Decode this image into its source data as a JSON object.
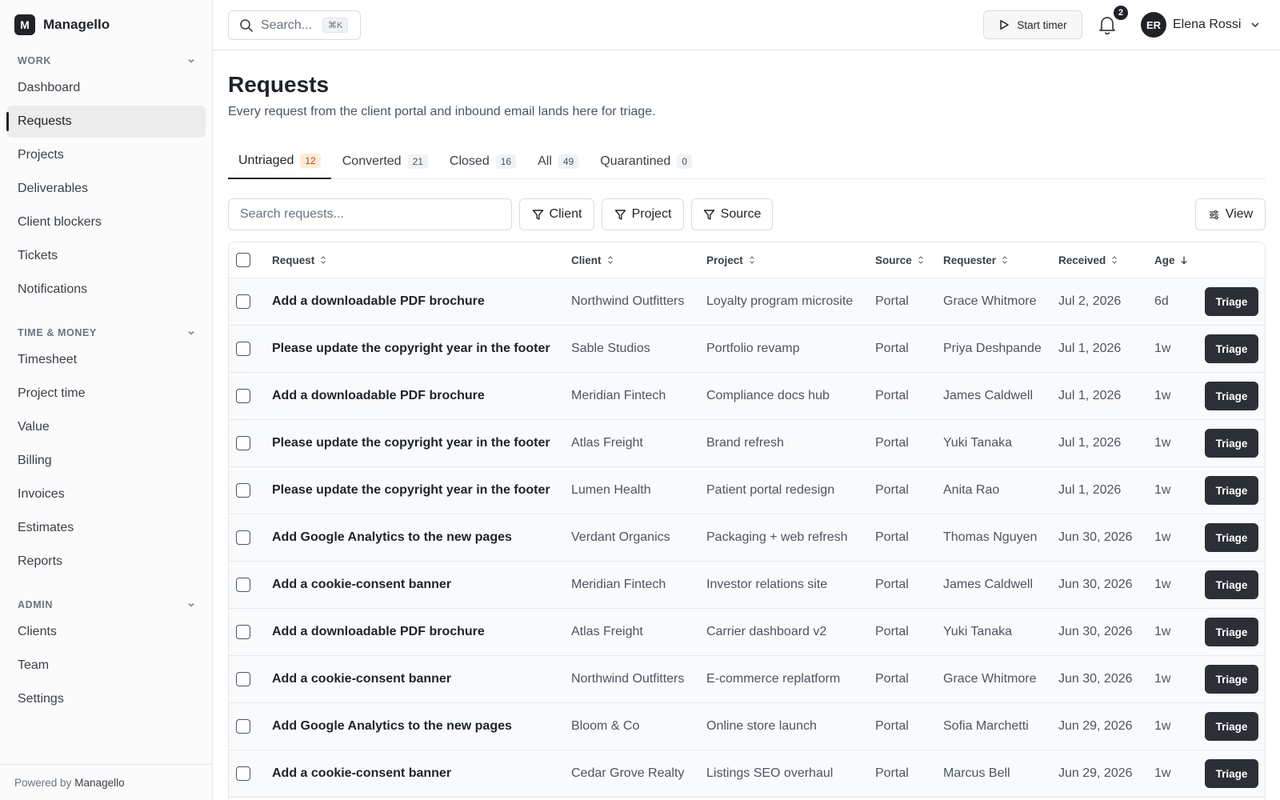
{
  "brand": {
    "logo_letter": "M",
    "name": "Managello"
  },
  "sidebar": {
    "sections": [
      {
        "title": "WORK",
        "items": [
          "Dashboard",
          "Requests",
          "Projects",
          "Deliverables",
          "Client blockers",
          "Tickets",
          "Notifications"
        ]
      },
      {
        "title": "TIME & MONEY",
        "items": [
          "Timesheet",
          "Project time",
          "Value",
          "Billing",
          "Invoices",
          "Estimates",
          "Reports"
        ]
      },
      {
        "title": "ADMIN",
        "items": [
          "Clients",
          "Team",
          "Settings"
        ]
      }
    ],
    "active_item": "Requests",
    "footer_prefix": "Powered by",
    "footer_brand": "Managello"
  },
  "topbar": {
    "search_placeholder": "Search...",
    "search_shortcut": "⌘K",
    "start_timer_label": "Start timer",
    "notification_count": "2",
    "user_initials": "ER",
    "user_name": "Elena Rossi"
  },
  "page": {
    "title": "Requests",
    "subtitle": "Every request from the client portal and inbound email lands here for triage."
  },
  "tabs": [
    {
      "label": "Untriaged",
      "count": "12",
      "active": true
    },
    {
      "label": "Converted",
      "count": "21",
      "active": false
    },
    {
      "label": "Closed",
      "count": "16",
      "active": false
    },
    {
      "label": "All",
      "count": "49",
      "active": false
    },
    {
      "label": "Quarantined",
      "count": "0",
      "active": false
    }
  ],
  "toolbar": {
    "search_placeholder": "Search requests...",
    "filter_client": "Client",
    "filter_project": "Project",
    "filter_source": "Source",
    "view_label": "View"
  },
  "table": {
    "columns": [
      "Request",
      "Client",
      "Project",
      "Source",
      "Requester",
      "Received",
      "Age"
    ],
    "action_label": "Triage",
    "rows": [
      [
        "Add a downloadable PDF brochure",
        "Northwind Outfitters",
        "Loyalty program microsite",
        "Portal",
        "Grace Whitmore",
        "Jul 2, 2026",
        "6d"
      ],
      [
        "Please update the copyright year in the footer",
        "Sable Studios",
        "Portfolio revamp",
        "Portal",
        "Priya Deshpande",
        "Jul 1, 2026",
        "1w"
      ],
      [
        "Add a downloadable PDF brochure",
        "Meridian Fintech",
        "Compliance docs hub",
        "Portal",
        "James Caldwell",
        "Jul 1, 2026",
        "1w"
      ],
      [
        "Please update the copyright year in the footer",
        "Atlas Freight",
        "Brand refresh",
        "Portal",
        "Yuki Tanaka",
        "Jul 1, 2026",
        "1w"
      ],
      [
        "Please update the copyright year in the footer",
        "Lumen Health",
        "Patient portal redesign",
        "Portal",
        "Anita Rao",
        "Jul 1, 2026",
        "1w"
      ],
      [
        "Add Google Analytics to the new pages",
        "Verdant Organics",
        "Packaging + web refresh",
        "Portal",
        "Thomas Nguyen",
        "Jun 30, 2026",
        "1w"
      ],
      [
        "Add a cookie-consent banner",
        "Meridian Fintech",
        "Investor relations site",
        "Portal",
        "James Caldwell",
        "Jun 30, 2026",
        "1w"
      ],
      [
        "Add a downloadable PDF brochure",
        "Atlas Freight",
        "Carrier dashboard v2",
        "Portal",
        "Yuki Tanaka",
        "Jun 30, 2026",
        "1w"
      ],
      [
        "Add a cookie-consent banner",
        "Northwind Outfitters",
        "E-commerce replatform",
        "Portal",
        "Grace Whitmore",
        "Jun 30, 2026",
        "1w"
      ],
      [
        "Add Google Analytics to the new pages",
        "Bloom & Co",
        "Online store launch",
        "Portal",
        "Sofia Marchetti",
        "Jun 29, 2026",
        "1w"
      ],
      [
        "Add a cookie-consent banner",
        "Cedar Grove Realty",
        "Listings SEO overhaul",
        "Portal",
        "Marcus Bell",
        "Jun 29, 2026",
        "1w"
      ]
    ]
  }
}
